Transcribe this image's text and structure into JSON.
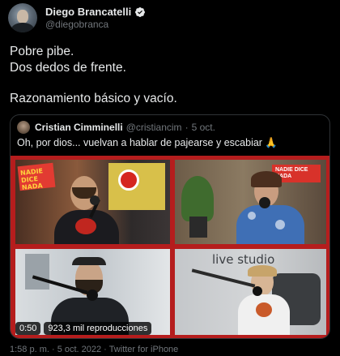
{
  "author": {
    "display_name": "Diego Brancatelli",
    "handle": "@diegobranca",
    "verified_icon": "verified-badge-icon"
  },
  "tweet": {
    "lines": [
      "Pobre pibe.",
      "Dos dedos de frente.",
      "",
      "Razonamiento básico y vacío."
    ]
  },
  "quoted": {
    "display_name": "Cristian Cimminelli",
    "handle": "@cristiancim",
    "separator": "·",
    "date": "5 oct.",
    "text": "Oh, por dios... vuelvan a hablar de pajearse y escabiar 🙏",
    "media": {
      "panel_texts": {
        "sign_left": "NADIE DICE NADA",
        "sign_right": "NADIE DICE NADA",
        "wall_text": "live studio"
      },
      "duration": "0:50",
      "views": "923,3 mil reproducciones"
    }
  },
  "footer": {
    "meta": "1:58 p. m. · 5 oct. 2022 · Twitter for iPhone"
  },
  "colors": {
    "background": "#000000",
    "text": "#e7e9ea",
    "muted": "#71767b",
    "border": "#2f3336",
    "verified": "#1d9bf0",
    "frame": "#b51d1d"
  }
}
